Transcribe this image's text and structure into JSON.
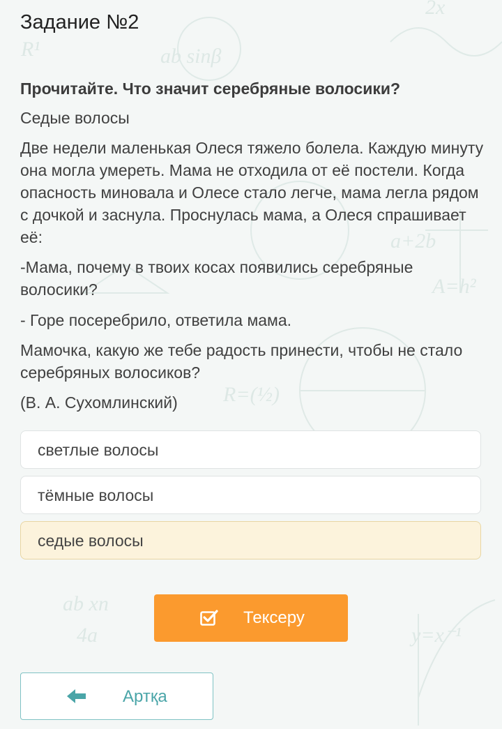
{
  "task": {
    "title": "Задание №2"
  },
  "question": {
    "prompt": "Прочитайте. Что значит серебряные волосики?",
    "answer_hint": "Седые волосы",
    "paragraph_1": "Две недели маленькая Олеся тяжело болела. Каждую минуту она могла умереть. Мама не отходила от её постели. Когда опасность миновала и Олесе стало легче, мама легла рядом с дочкой и заснула. Проснулась мама, а Олеся спрашивает её:",
    "paragraph_2": "-Мама, почему в твоих косах появились серебряные волосики?",
    "paragraph_3": "- Горе посеребрило, ответила мама.",
    "paragraph_4": "Мамочка, какую же тебе радость принести, чтобы не стало серебряных волосиков?",
    "author": "(В. А. Сухомлинский)"
  },
  "options": [
    {
      "label": "светлые волосы",
      "selected": false
    },
    {
      "label": "тёмные волосы",
      "selected": false
    },
    {
      "label": "седые волосы",
      "selected": true
    }
  ],
  "buttons": {
    "check_label": "Тексеру",
    "check_icon": "check-square-icon",
    "back_label": "Артқа",
    "back_icon": "arrow-left-icon"
  },
  "colors": {
    "accent_orange": "#fb9a2e",
    "accent_teal": "#4aa5a8",
    "selected_bg": "#fcf3dc"
  }
}
